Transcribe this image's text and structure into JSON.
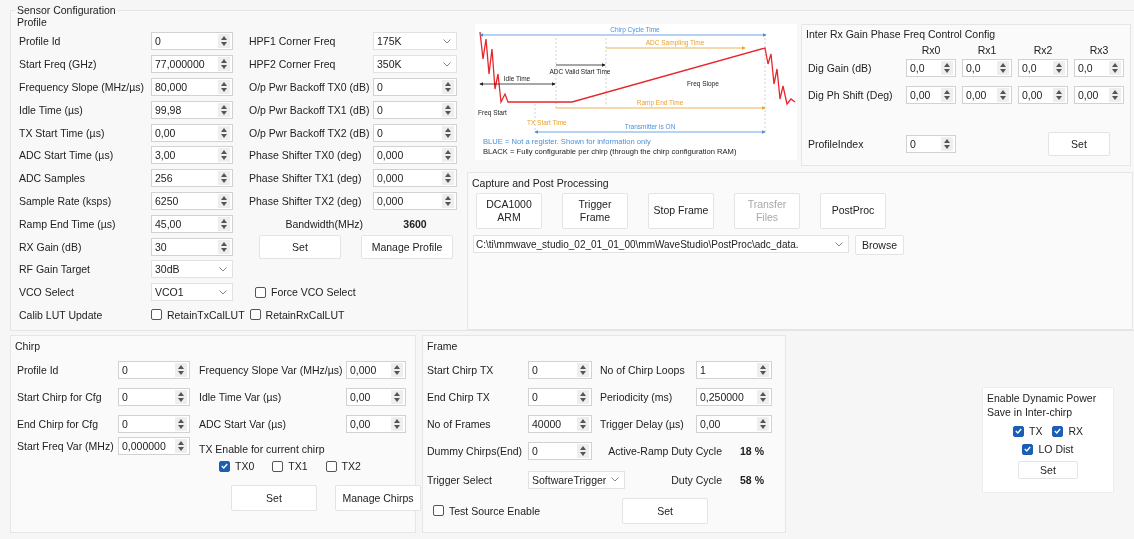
{
  "sensor_configuration": {
    "title": "Sensor Configuration"
  },
  "profile": {
    "title": "Profile",
    "rows": [
      {
        "left": {
          "kind": "spin",
          "label": "Profile Id",
          "value": "0"
        },
        "right": {
          "kind": "combo",
          "label": "HPF1 Corner Freq",
          "value": "175K"
        }
      },
      {
        "left": {
          "kind": "spin",
          "label": "Start Freq (GHz)",
          "value": "77,000000"
        },
        "right": {
          "kind": "combo",
          "label": "HPF2 Corner Freq",
          "value": "350K"
        }
      },
      {
        "left": {
          "kind": "spin",
          "label": "Frequency Slope (MHz/µs)",
          "value": "80,000"
        },
        "right": {
          "kind": "spin",
          "label": "O/p Pwr Backoff TX0 (dB)",
          "value": "0"
        }
      },
      {
        "left": {
          "kind": "spin",
          "label": "Idle Time (µs)",
          "value": "99,98"
        },
        "right": {
          "kind": "spin",
          "label": "O/p Pwr Backoff TX1 (dB)",
          "value": "0"
        }
      },
      {
        "left": {
          "kind": "spin",
          "label": "TX Start Time (µs)",
          "value": "0,00"
        },
        "right": {
          "kind": "spin",
          "label": "O/p Pwr Backoff TX2 (dB)",
          "value": "0"
        }
      },
      {
        "left": {
          "kind": "spin",
          "label": "ADC Start Time (µs)",
          "value": "3,00"
        },
        "right": {
          "kind": "spin",
          "label": "Phase Shifter TX0 (deg)",
          "value": "0,000"
        }
      },
      {
        "left": {
          "kind": "spin",
          "label": "ADC Samples",
          "value": "256"
        },
        "right": {
          "kind": "spin",
          "label": "Phase Shifter TX1 (deg)",
          "value": "0,000"
        }
      },
      {
        "left": {
          "kind": "spin",
          "label": "Sample Rate (ksps)",
          "value": "6250"
        },
        "right": {
          "kind": "spin",
          "label": "Phase Shifter TX2 (deg)",
          "value": "0,000"
        }
      },
      {
        "left": {
          "kind": "spin",
          "label": "Ramp End Time (µs)",
          "value": "45,00"
        },
        "right": {
          "kind": "readout",
          "label": "Bandwidth(MHz)",
          "value": "3600"
        }
      },
      {
        "left": {
          "kind": "spin",
          "label": "RX Gain (dB)",
          "value": "30"
        },
        "right": {
          "kind": "buttons",
          "buttons": [
            {
              "label": "Set"
            },
            {
              "label": "Manage Profile"
            }
          ]
        }
      },
      {
        "left": {
          "kind": "combo",
          "label": "RF Gain Target",
          "value": "30dB"
        }
      },
      {
        "left": {
          "kind": "combo",
          "label": "VCO Select",
          "value": "VCO1"
        },
        "right": {
          "kind": "checkbox",
          "label": "Force VCO Select",
          "checked": false
        }
      },
      {
        "left": {
          "kind": "checks",
          "label": "Calib LUT Update",
          "options": [
            {
              "label": "RetainTxCalLUT",
              "checked": false
            },
            {
              "label": "RetainRxCalLUT",
              "checked": false
            }
          ]
        }
      }
    ]
  },
  "diagram": {
    "labels": [
      "Chirp Cycle Time",
      "ADC Sampling Time",
      "ADC Valid Start Time",
      "Idle Time",
      "Freq Slope",
      "Freq Start",
      "Ramp End Time",
      "TX Start Time",
      "Transmitter is ON"
    ],
    "legend": [
      "BLUE = Not a register. Shown for information only",
      "BLACK = Fully configurable per chirp (through the chirp configuration RAM)"
    ]
  },
  "inter_rx": {
    "title": "Inter Rx Gain Phase Freq Control Config",
    "columns": [
      "Rx0",
      "Rx1",
      "Rx2",
      "Rx3"
    ],
    "rows": [
      {
        "label": "Dig Gain (dB)",
        "values": [
          "0,0",
          "0,0",
          "0,0",
          "0,0"
        ]
      },
      {
        "label": "Dig Ph Shift (Deg)",
        "values": [
          "0,00",
          "0,00",
          "0,00",
          "0,00"
        ]
      }
    ],
    "profile_index": {
      "label": "ProfileIndex",
      "value": "0"
    },
    "button": "Set"
  },
  "capture": {
    "title": "Capture and Post Processing",
    "buttons": [
      {
        "label": "DCA1000 ARM",
        "disabled": false
      },
      {
        "label": "Trigger Frame",
        "disabled": false
      },
      {
        "label": "Stop Frame",
        "disabled": false
      },
      {
        "label": "Transfer Files",
        "disabled": true
      },
      {
        "label": "PostProc",
        "disabled": false
      }
    ],
    "path": "C:\\ti\\mmwave_studio_02_01_01_00\\mmWaveStudio\\PostProc\\adc_data.",
    "browse": "Browse"
  },
  "chirp": {
    "title": "Chirp",
    "rows": [
      {
        "left": {
          "kind": "spin",
          "label": "Profile Id",
          "value": "0"
        },
        "right": {
          "kind": "spin",
          "label": "Frequency Slope Var (MHz/µs)",
          "value": "0,000"
        }
      },
      {
        "left": {
          "kind": "spin",
          "label": "Start Chirp for Cfg",
          "value": "0"
        },
        "right": {
          "kind": "spin",
          "label": "Idle Time Var (µs)",
          "value": "0,00"
        }
      },
      {
        "left": {
          "kind": "spin",
          "label": "End Chirp for Cfg",
          "value": "0"
        },
        "right": {
          "kind": "spin",
          "label": "ADC Start Var (µs)",
          "value": "0,00"
        }
      },
      {
        "left": {
          "kind": "spin",
          "label": "Start Freq Var (MHz)",
          "value": "0,000000"
        },
        "right": {
          "kind": "checkgroup",
          "label": "TX Enable for current chirp",
          "options": [
            {
              "label": "TX0",
              "checked": true
            },
            {
              "label": "TX1",
              "checked": false
            },
            {
              "label": "TX2",
              "checked": false
            }
          ]
        }
      },
      {
        "right": {
          "kind": "buttons",
          "buttons": [
            {
              "label": "Set"
            },
            {
              "label": "Manage Chirps"
            }
          ]
        }
      }
    ]
  },
  "frame": {
    "title": "Frame",
    "rows": [
      {
        "left": {
          "kind": "spin",
          "label": "Start Chirp TX",
          "value": "0"
        },
        "right": {
          "kind": "spin",
          "label": "No of Chirp Loops",
          "value": "1"
        }
      },
      {
        "left": {
          "kind": "spin",
          "label": "End Chirp TX",
          "value": "0"
        },
        "right": {
          "kind": "spin",
          "label": "Periodicity (ms)",
          "value": "0,250000"
        }
      },
      {
        "left": {
          "kind": "spin",
          "label": "No of Frames",
          "value": "40000"
        },
        "right": {
          "kind": "spin",
          "label": "Trigger Delay (µs)",
          "value": "0,00"
        }
      },
      {
        "left": {
          "kind": "spin",
          "label": "Dummy Chirps(End)",
          "value": "0"
        },
        "right": {
          "kind": "readout",
          "label": "Active-Ramp Duty Cycle",
          "value": "18 %"
        }
      },
      {
        "left": {
          "kind": "combo",
          "label": "Trigger Select",
          "value": "SoftwareTrigger"
        },
        "right": {
          "kind": "readout",
          "label": "Duty Cycle",
          "value": "58 %"
        }
      },
      {
        "left": {
          "kind": "checkbox",
          "label": "Test Source Enable",
          "checked": false
        },
        "right": {
          "kind": "buttons",
          "buttons": [
            {
              "label": "Set"
            }
          ]
        }
      }
    ]
  },
  "dynamic_power_save": {
    "title": "Enable Dynamic Power Save in Inter-chirp",
    "option_rows": [
      {
        "options": [
          {
            "label": "TX",
            "checked": true
          },
          {
            "label": "RX",
            "checked": true
          }
        ]
      },
      {
        "options": [
          {
            "label": "LO Dist",
            "checked": true
          }
        ]
      }
    ],
    "button": "Set"
  }
}
